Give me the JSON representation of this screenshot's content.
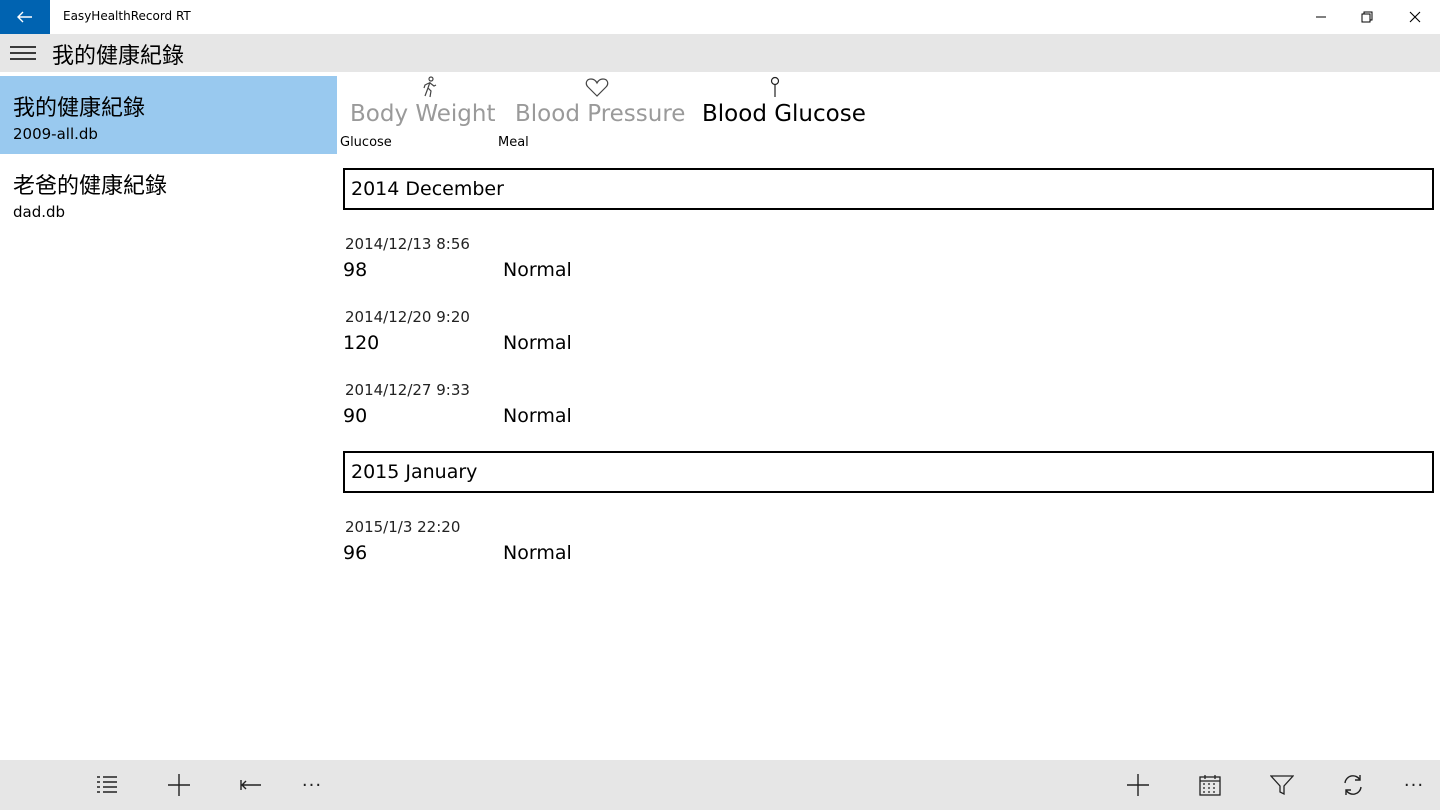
{
  "window": {
    "app_title": "EasyHealthRecord RT",
    "accent": "#0063b1"
  },
  "header": {
    "title": "我的健康紀錄"
  },
  "sidebar": {
    "items": [
      {
        "name": "我的健康紀錄",
        "file": "2009-all.db",
        "selected": true
      },
      {
        "name": "老爸的健康紀錄",
        "file": "dad.db",
        "selected": false
      }
    ],
    "selected_color": "#99c9ef"
  },
  "pivot": {
    "tabs": [
      {
        "label": "Body Weight",
        "icon": "walking-person-icon",
        "active": false
      },
      {
        "label": "Blood Pressure",
        "icon": "heart-icon",
        "active": false
      },
      {
        "label": "Blood Glucose",
        "icon": "pin-icon",
        "active": true
      }
    ]
  },
  "columns": {
    "value_header": "Glucose",
    "status_header": "Meal"
  },
  "groups": [
    {
      "label": "2014  December",
      "records": [
        {
          "datetime": "2014/12/13 8:56",
          "value": "98",
          "status": "Normal"
        },
        {
          "datetime": "2014/12/20 9:20",
          "value": "120",
          "status": "Normal"
        },
        {
          "datetime": "2014/12/27 9:33",
          "value": "90",
          "status": "Normal"
        }
      ]
    },
    {
      "label": "2015  January",
      "records": [
        {
          "datetime": "2015/1/3 22:20",
          "value": "96",
          "status": "Normal"
        }
      ]
    }
  ],
  "appbar": {
    "left_buttons": [
      "list-icon",
      "add-icon",
      "back-arrow-icon",
      "more-icon"
    ],
    "right_buttons": [
      "add-icon",
      "calendar-icon",
      "filter-icon",
      "sync-icon",
      "more-icon"
    ],
    "more_glyph": "···"
  }
}
